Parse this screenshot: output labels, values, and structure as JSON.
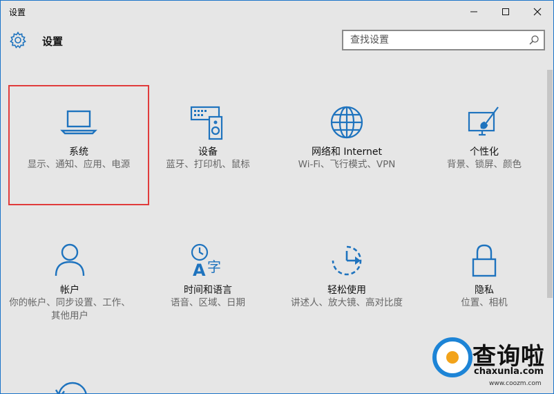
{
  "window": {
    "title": "设置",
    "controls": {
      "minimize": "minimize-icon",
      "maximize": "maximize-icon",
      "close": "close-icon"
    }
  },
  "header": {
    "label": "设置",
    "icon": "gear-icon",
    "search_placeholder": "查找设置",
    "search_icon": "search-icon"
  },
  "colors": {
    "accent": "#1a73c9",
    "icon": "#1e73be",
    "selection": "#e03b3b",
    "background": "#e6e6e6"
  },
  "tiles": [
    {
      "name": "系统",
      "desc": "显示、通知、应用、电源",
      "icon": "laptop-icon",
      "selected": true
    },
    {
      "name": "设备",
      "desc": "蓝牙、打印机、鼠标",
      "icon": "devices-icon"
    },
    {
      "name": "网络和 Internet",
      "desc": "Wi-Fi、飞行模式、VPN",
      "icon": "globe-icon"
    },
    {
      "name": "个性化",
      "desc": "背景、锁屏、颜色",
      "icon": "paint-icon"
    },
    {
      "name": "帐户",
      "desc": "你的帐户、同步设置、工作、其他用户",
      "icon": "person-icon"
    },
    {
      "name": "时间和语言",
      "desc": "语音、区域、日期",
      "icon": "time-language-icon"
    },
    {
      "name": "轻松使用",
      "desc": "讲述人、放大镜、高对比度",
      "icon": "ease-of-access-icon"
    },
    {
      "name": "隐私",
      "desc": "位置、相机",
      "icon": "lock-icon"
    }
  ],
  "watermark": {
    "text": "查询啦",
    "domain": "chaxunla.com",
    "small": "www.coozm.com"
  }
}
